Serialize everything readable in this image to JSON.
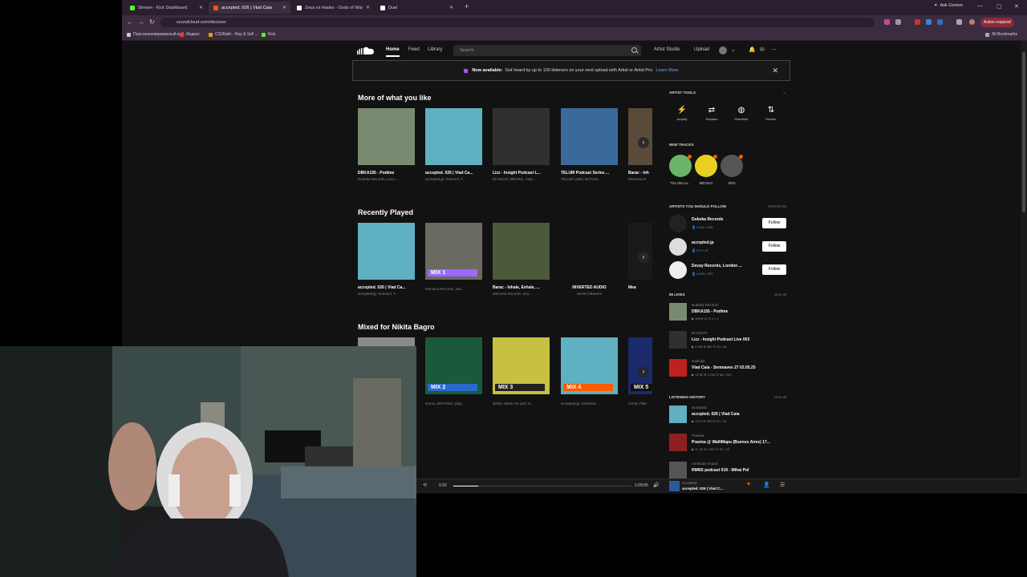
{
  "browser": {
    "tabs": [
      {
        "label": "Stream - Kick Dashboard",
        "color": "#53fc18",
        "active": false
      },
      {
        "label": "accepted. 026 | Vlad Caia",
        "color": "#ff5500",
        "active": true
      },
      {
        "label": "Zeus vs Hades - Gods of War",
        "color": "#ffffff",
        "active": false
      },
      {
        "label": "Duel",
        "color": "#ffffff",
        "active": false
      }
    ],
    "ask_gemini": "Ask Gemini",
    "url": "soundcloud.com/discover",
    "action_required": "Action required",
    "bookmarks": [
      "Персонализированный веб...",
      "Яндекс",
      "CS2Кейс - Buy & Sell ...",
      "Kick"
    ],
    "all_bookmarks": "All Bookmarks"
  },
  "header": {
    "nav": [
      "Home",
      "Feed",
      "Library"
    ],
    "search_placeholder": "Search",
    "artist_studio": "Artist Studio",
    "upload": "Upload"
  },
  "banner": {
    "bold": "Now available:",
    "text": "Get heard by up to 100 listeners on your next upload with Artist or Artist Pro.",
    "link": "Learn More"
  },
  "sections": [
    {
      "title": "More of what you like",
      "items": [
        {
          "title": "DBKA155 - Podime",
          "sub": "Dubeka Records, Luca ...",
          "art": "#7a8a70"
        },
        {
          "title": "accepted. 026 | Vlad Ca...",
          "sub": "accepted.jp, trommel, T...",
          "art": "#5fb0c0"
        },
        {
          "title": "Lizz - Insight Podcast L...",
          "sub": "IN:SIGHT, MEOKO, Cale...",
          "art": "#303030"
        },
        {
          "title": "TELUM Podcast Series ...",
          "sub": "TELUM Label, BOTANI...",
          "art": "#3a6a9a"
        },
        {
          "title": "Barac - Inh",
          "sub": "Memoria R",
          "art": "#5a4a3a"
        }
      ]
    },
    {
      "title": "Recently Played",
      "items": [
        {
          "title": "accepted. 026 | Vlad Ca...",
          "sub": "accepted.jp, trommel, T...",
          "art": "#5fb0c0"
        },
        {
          "title": "",
          "sub": "Mironica Records, anit...",
          "art": "#6a6a60",
          "mix": "MIX 1",
          "mixcolor": "#9b6bff"
        },
        {
          "title": "Barac - Inhale, Exhale, ...",
          "sub": "Memoria Records, stor...",
          "art": "#4a5a3a"
        },
        {
          "title": "INVERTED AUDIO",
          "sub": "59.6K followers",
          "art": "#111111",
          "round": true
        },
        {
          "title": "Mea",
          "sub": "",
          "art": "#1a1a1a"
        }
      ]
    },
    {
      "title": "Mixed for Nikita Bagro",
      "items": [
        {
          "title": "",
          "sub": "",
          "art": "#8a8a8a"
        },
        {
          "title": "",
          "sub": "Gorou, BOTANIC, play...",
          "art": "#1a5a3a",
          "mix": "MIX 2",
          "mixcolor": "#2a6ad0"
        },
        {
          "title": "",
          "sub": "dimkit, Martin M, jazz re...",
          "art": "#c8c040",
          "mix": "MIX 3",
          "mixcolor": "#222222"
        },
        {
          "title": "",
          "sub": "accepted.jp, romanian ...",
          "art": "#5fb0c0",
          "mix": "MIX 4",
          "mixcolor": "#ff5a00"
        },
        {
          "title": "",
          "sub": "Acmé, Fide",
          "art": "#1a2a6a",
          "mix": "MIX 5",
          "mixcolor": "#111111"
        }
      ]
    }
  ],
  "sidebar": {
    "artist_tools": "ARTIST TOOLS",
    "tools": [
      {
        "label": "Amplify",
        "icon": "⚡"
      },
      {
        "label": "Replace",
        "icon": "⇄"
      },
      {
        "label": "Distribute",
        "icon": "◍"
      },
      {
        "label": "Monitor",
        "icon": "⇅"
      }
    ],
    "new_tracks": "NEW TRACKS",
    "new_track_items": [
      {
        "label": "TELUM La...",
        "color": "#6ab56a"
      },
      {
        "label": "MEOKO",
        "color": "#e8d020"
      },
      {
        "label": "SRS",
        "color": "#555555"
      }
    ],
    "artists_head": "ARTISTS YOU SHOULD FOLLOW",
    "refresh": "Refresh list",
    "artists": [
      {
        "name": "Dubeka Records",
        "stats": "👤 9,242   ▪ 438",
        "color": "#222222"
      },
      {
        "name": "accepted.jp",
        "stats": "👤 977   ▪ 87",
        "color": "#dddddd"
      },
      {
        "name": "Decay Records, London ...",
        "stats": "👤 4,035   ▪ 229",
        "color": "#eeeeee"
      }
    ],
    "follow": "Follow",
    "likes_head": "86 LIKES",
    "view_all": "View all",
    "likes": [
      {
        "user": "Dubeka Records",
        "title": "DBKA155 - Podime",
        "stats": "▶ 183  ♥ 11  ⟳ 2  ▪ 1",
        "color": "#7a8a70"
      },
      {
        "user": "IN:SIGHT",
        "title": "Lizz - Insight Podcast Live 003",
        "stats": "▶ 6,960  ♥ 482  ⟳ 23  ▪ 48",
        "color": "#303030"
      },
      {
        "user": "vladcaia",
        "title": "Vlad Caia - Semnaves 27 02.05.25",
        "stats": "▶ 13.3K  ♥ 1,206  ⟳ 66  ▪ 153",
        "color": "#c02020"
      }
    ],
    "history_head": "LISTENING HISTORY",
    "history": [
      {
        "user": "accepted.",
        "title": "accepted. 026 | Vlad Caia",
        "stats": "▶ 107K  ♥ 788  ⟳ 50  ▪ 23",
        "color": "#5fb0c0"
      },
      {
        "user": "Prasiea",
        "title": "Prasiea @ WalliMapu (Buenos Aires) 17...",
        "stats": "▶ 21.3K  ♥ 1,057  ⟳ 62  ▪ 24",
        "color": "#902020"
      },
      {
        "user": "romanian sound",
        "title": "RMNS podcast 019 - Mihai Pol",
        "stats": "",
        "color": "#555555"
      }
    ]
  },
  "player": {
    "time_elapsed": "9:32",
    "time_total": "1:09:05",
    "progress": 0.14,
    "user": "accepted.",
    "title": "accepted. 026 | Vlad C..."
  }
}
